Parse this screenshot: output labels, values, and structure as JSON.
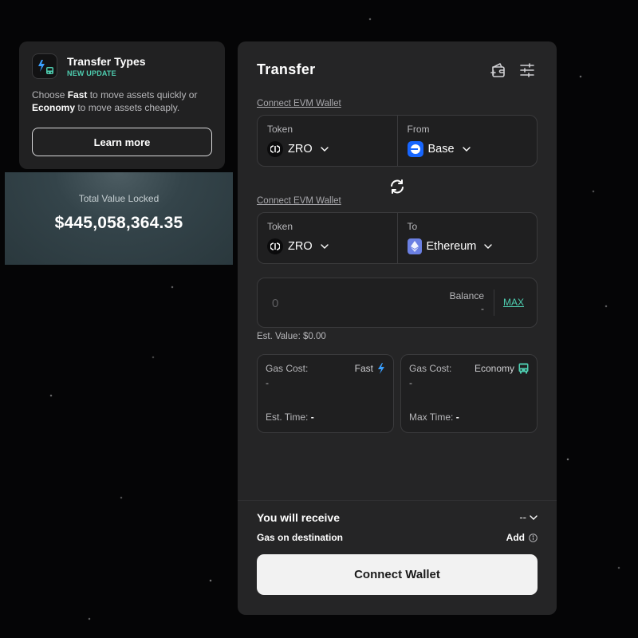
{
  "transfer_types": {
    "title": "Transfer Types",
    "badge": "NEW UPDATE",
    "desc_prefix": "Choose ",
    "desc_fast": "Fast",
    "desc_middle": " to move assets quickly or ",
    "desc_economy": "Economy",
    "desc_suffix": " to move assets cheaply.",
    "learn_more_label": "Learn more"
  },
  "tvl": {
    "label": "Total Value Locked",
    "value": "$445,058,364.35"
  },
  "transfer": {
    "title": "Transfer",
    "source": {
      "connect_label": "Connect EVM Wallet",
      "token_label": "Token",
      "token": "ZRO",
      "chain_label": "From",
      "chain": "Base"
    },
    "destination": {
      "connect_label": "Connect EVM Wallet",
      "token_label": "Token",
      "token": "ZRO",
      "chain_label": "To",
      "chain": "Ethereum"
    },
    "amount": {
      "placeholder": "0",
      "balance_label": "Balance",
      "balance_value": "-",
      "max_label": "MAX"
    },
    "est_value": "Est. Value: $0.00",
    "options": {
      "fast": {
        "gas_label": "Gas Cost:",
        "name": "Fast",
        "gas_value": "-",
        "time_label": "Est. Time:",
        "time_value": "-"
      },
      "economy": {
        "gas_label": "Gas Cost:",
        "name": "Economy",
        "gas_value": "-",
        "time_label": "Max Time:",
        "time_value": "-"
      }
    },
    "receive_label": "You will receive",
    "receive_value": "--",
    "gas_destination_label": "Gas on destination",
    "gas_add_label": "Add",
    "connect_wallet_label": "Connect Wallet"
  },
  "colors": {
    "accent_teal": "#4ecdb0",
    "fast_blue": "#3aa0ff",
    "base_blue": "#1766ff",
    "eth_purple": "#6b80e3",
    "panel_bg": "#252526"
  },
  "icons": {
    "types": "bolt-bus-icon",
    "wallet": "wallet-add-icon",
    "settings": "sliders-icon",
    "swap": "swap-arrows-icon",
    "fast": "lightning-icon",
    "economy": "bus-icon",
    "info": "info-icon"
  }
}
